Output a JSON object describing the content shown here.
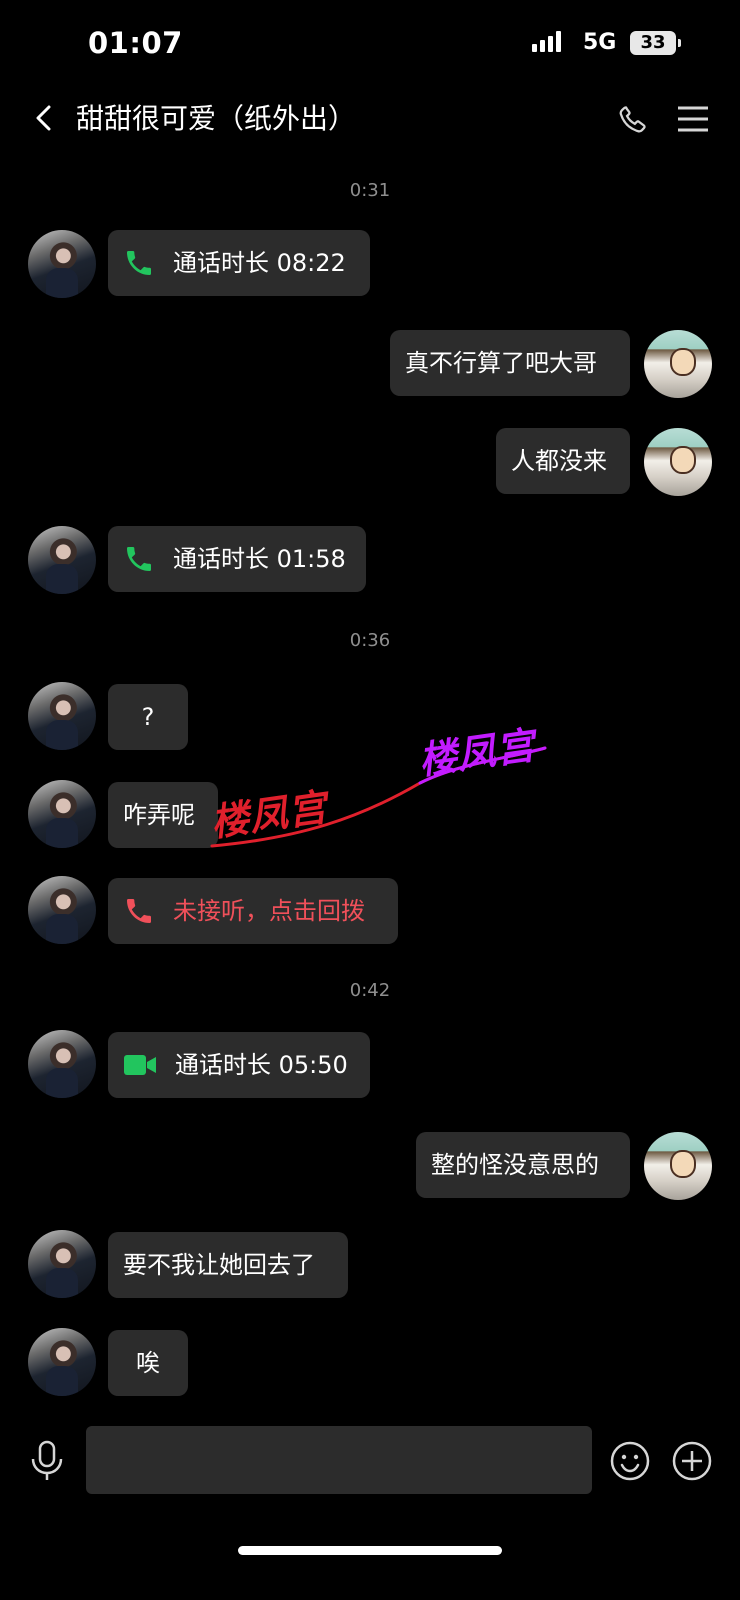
{
  "status": {
    "time": "01:07",
    "network": "5G",
    "battery": "33"
  },
  "header": {
    "title": "甜甜很可爱（纸外出）"
  },
  "timestamps": [
    "0:31",
    "0:36",
    "0:42"
  ],
  "messages": {
    "m1": {
      "text": "通话时长 08:22",
      "icon": "phone-icon"
    },
    "m2": {
      "text": "真不行算了吧大哥"
    },
    "m3": {
      "text": "人都没来"
    },
    "m4": {
      "text": "通话时长 01:58",
      "icon": "phone-icon"
    },
    "m5": {
      "text": "?"
    },
    "m6": {
      "text": "咋弄呢"
    },
    "m7": {
      "text": "未接听，点击回拨",
      "icon": "phone-missed-icon"
    },
    "m8": {
      "text": "通话时长 05:50",
      "icon": "video-call-icon"
    },
    "m9": {
      "text": "整的怪没意思的"
    },
    "m10": {
      "text": "要不我让她回去了"
    },
    "m11": {
      "text": "唉"
    }
  },
  "watermark": {
    "text1": "楼凤宫",
    "text2": "楼凤宫"
  },
  "colors": {
    "green": "#22c55e",
    "missed": "#f0505a",
    "bubble": "#2c2c2c",
    "wm_red": "#e0202c",
    "wm_purple": "#c21cff"
  }
}
